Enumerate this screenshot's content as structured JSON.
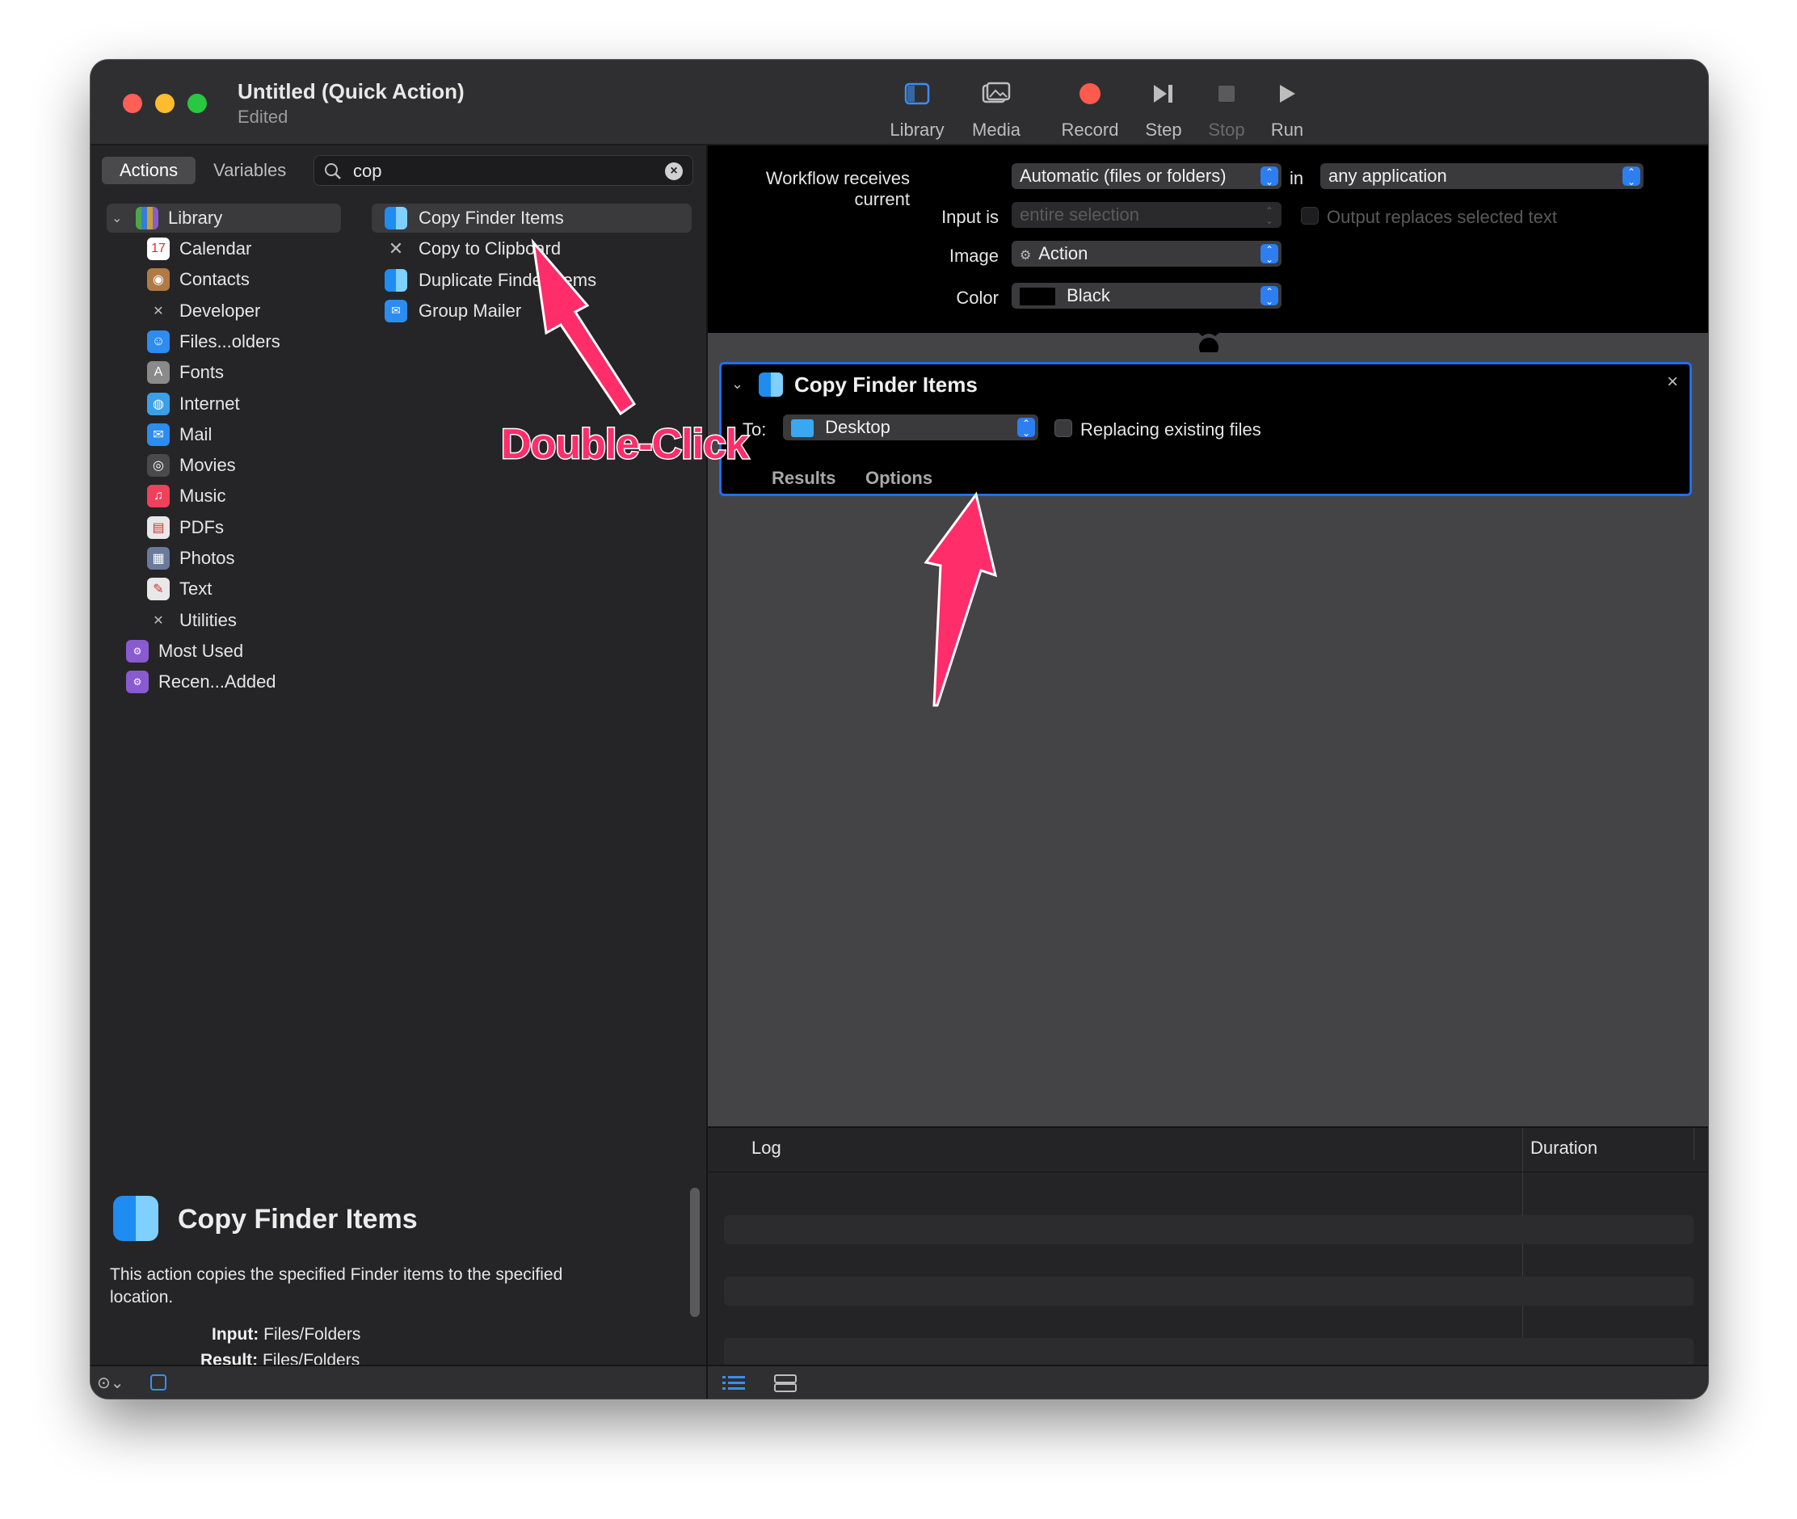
{
  "window": {
    "title": "Untitled (Quick Action)",
    "subtitle": "Edited"
  },
  "toolbar": {
    "library": "Library",
    "media": "Media",
    "record": "Record",
    "step": "Step",
    "stop": "Stop",
    "run": "Run"
  },
  "left": {
    "tabs": [
      "Actions",
      "Variables"
    ],
    "search_value": "cop",
    "library_header": "Library",
    "library_items": [
      {
        "label": "Calendar",
        "icon": "calendar-icon",
        "color": "#ffffff"
      },
      {
        "label": "Contacts",
        "icon": "contacts-icon",
        "color": "#b07a45"
      },
      {
        "label": "Developer",
        "icon": "tools-icon",
        "color": "#9a9a9a"
      },
      {
        "label": "Files...olders",
        "icon": "finder-icon",
        "color": "#2d8cf0"
      },
      {
        "label": "Fonts",
        "icon": "fonts-icon",
        "color": "#8a8a8a"
      },
      {
        "label": "Internet",
        "icon": "globe-icon",
        "color": "#3aa0e8"
      },
      {
        "label": "Mail",
        "icon": "mail-icon",
        "color": "#2d8cf0"
      },
      {
        "label": "Movies",
        "icon": "quicktime-icon",
        "color": "#4a4a4c"
      },
      {
        "label": "Music",
        "icon": "music-icon",
        "color": "#f0405a"
      },
      {
        "label": "PDFs",
        "icon": "pdf-icon",
        "color": "#e8e8e8"
      },
      {
        "label": "Photos",
        "icon": "photos-icon",
        "color": "#6a7a9a"
      },
      {
        "label": "Text",
        "icon": "text-icon",
        "color": "#e8e8e8"
      },
      {
        "label": "Utilities",
        "icon": "tools-icon",
        "color": "#9a9a9a"
      }
    ],
    "smart_groups": [
      {
        "label": "Most Used",
        "icon": "smart-folder-icon"
      },
      {
        "label": "Recen...Added",
        "icon": "smart-folder-icon"
      }
    ],
    "results": [
      {
        "label": "Copy Finder Items",
        "icon": "finder-icon"
      },
      {
        "label": "Copy to Clipboard",
        "icon": "tools-icon"
      },
      {
        "label": "Duplicate Finder Items",
        "icon": "finder-icon"
      },
      {
        "label": "Group Mailer",
        "icon": "mail-icon"
      }
    ],
    "description": {
      "title": "Copy Finder Items",
      "text": "This action copies the specified Finder items to the specified location.",
      "input_label": "Input:",
      "input_value": "Files/Folders",
      "result_label": "Result:",
      "result_value": "Files/Folders"
    }
  },
  "workflow": {
    "receives_label": "Workflow receives current",
    "receives_value": "Automatic (files or folders)",
    "in_label": "in",
    "in_value": "any application",
    "input_is_label": "Input is",
    "input_is_value": "entire selection",
    "output_replaces": "Output replaces selected text",
    "image_label": "Image",
    "image_value": "Action",
    "color_label": "Color",
    "color_value": "Black"
  },
  "action": {
    "title": "Copy Finder Items",
    "to_label": "To:",
    "to_value": "Desktop",
    "replacing": "Replacing existing files",
    "tab_results": "Results",
    "tab_options": "Options"
  },
  "log": {
    "col_log": "Log",
    "col_duration": "Duration"
  },
  "annotation": {
    "text": "Double-Click",
    "color": "#ff2d6a"
  }
}
